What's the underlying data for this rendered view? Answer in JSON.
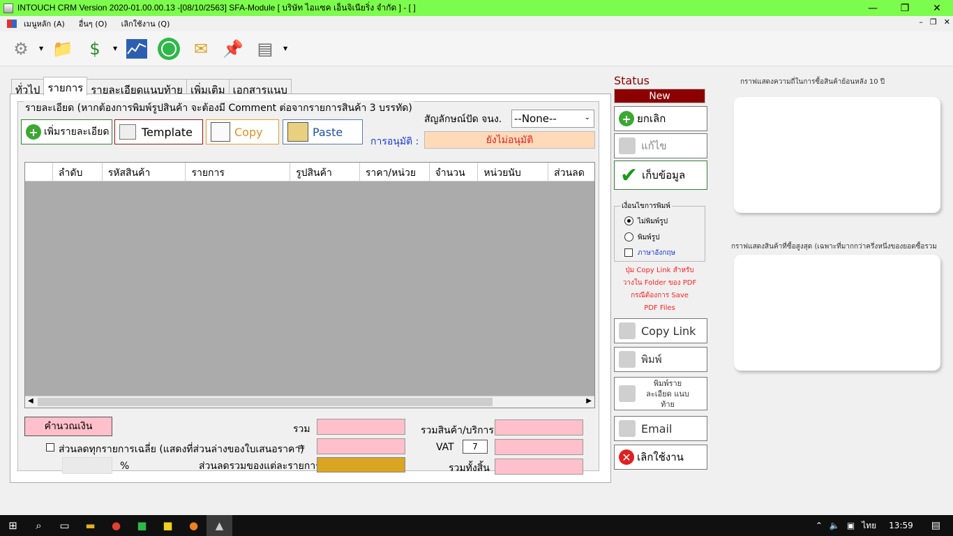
{
  "window": {
    "title": "INTOUCH CRM Version 2020-01.00.00.13 -[08/10/2563] SFA-Module  [ บริษัท ไอแซค เอ็นจิเนียริ่ง จำกัด ] - [ ]",
    "minimize": "—",
    "restore": "❐",
    "close": "✕"
  },
  "menu": {
    "items": [
      "เมนูหลัก (A)",
      "อื่นๆ (O)",
      "เลิกใช้งาน (Q)"
    ],
    "mdi_min": "–",
    "mdi_restore": "❐",
    "mdi_close": "✕"
  },
  "toolbar": {
    "icons": [
      "gear-icon",
      "document-icon",
      "money-bag-icon",
      "chart-icon",
      "whatsapp-icon",
      "envelope-icon",
      "pin-icon",
      "report-icon"
    ]
  },
  "tabs": [
    "ทั่วไป",
    "รายการ",
    "รายละเอียดแนบท้าย",
    "เพิ่มเติม",
    "เอกสารแนบ"
  ],
  "active_tab": 1,
  "details": {
    "group_title": "รายละเอียด (หากต้องการพิมพ์รูปสินค้า จะต้องมี Comment ต่อจากรายการสินค้า 3 บรรทัด)",
    "add_detail": "เพิ่มรายละเอียด",
    "template": "Template",
    "copy": "Copy",
    "paste": "Paste",
    "rounding_label": "สัญลักษณ์ปัด จนง.",
    "rounding_value": "--None--",
    "approval_label": "การอนุมัติ :",
    "approval_value": "ยังไม่อนุมัติ"
  },
  "table": {
    "columns": [
      "",
      "ลำดับ",
      "รหัสสินค้า",
      "รายการ",
      "รูปสินค้า",
      "ราคา/หน่วย",
      "จำนวน",
      "หน่วยนับ",
      "ส่วนลด"
    ],
    "rows": []
  },
  "summary": {
    "calc_button": "คำนวณเงิน",
    "avg_discount_label": "ส่วนลดทุกรายการเฉลี่ย (แสดงที่ส่วนล่างของใบเสนอราคา)",
    "percent": "%",
    "total_label": "รวม",
    "equals": "=",
    "item_discount_label": "ส่วนลดรวมของแต่ละรายการ",
    "goods_total_label": "รวมสินค้า/บริการ",
    "vat_label": "VAT",
    "vat_value": "7",
    "grand_total_label": "รวมทั้งสิ้น"
  },
  "status": {
    "label": "Status",
    "value": "New",
    "cancel": "ยกเลิก",
    "edit": "แก้ไข",
    "save": "เก็บข้อมูล",
    "print_options_title": "เงื่อนไขการพิมพ์",
    "no_image": "ไม่พิมพ์รูป",
    "with_image": "พิมพ์รูป",
    "english": "ภาษาอังกฤษ",
    "note": [
      "ปุ่ม Copy Link สำหรับ",
      "วางใน Folder ของ PDF",
      "กรณีต้องการ Save",
      "PDF Files"
    ],
    "copy_link": "Copy Link",
    "print": "พิมพ์",
    "print_detail": "พิมพ์รายละเอียด แนบท้าย",
    "email": "Email",
    "quit": "เลิกใช้งาน"
  },
  "charts": {
    "chart1_title": "กราฟแสดงความถี่ในการซื้อสินค้าย้อนหลัง 10 ปี",
    "chart2_title": "กราฟแสดงสินค้าที่ซื้อสูงสุด (เฉพาะที่มากกว่าครึ่งหนึ่งของยอดซื้อรวม"
  },
  "taskbar": {
    "language": "ไทย",
    "time": "13:59"
  },
  "colors": {
    "titlebar": "#7cfc4c",
    "status_bg": "#8b0000",
    "pink": "#ffc0cb",
    "gold": "#daa520",
    "approval_bg": "#ffdab9",
    "approval_text": "#e02020",
    "note_text": "#ff2020"
  }
}
